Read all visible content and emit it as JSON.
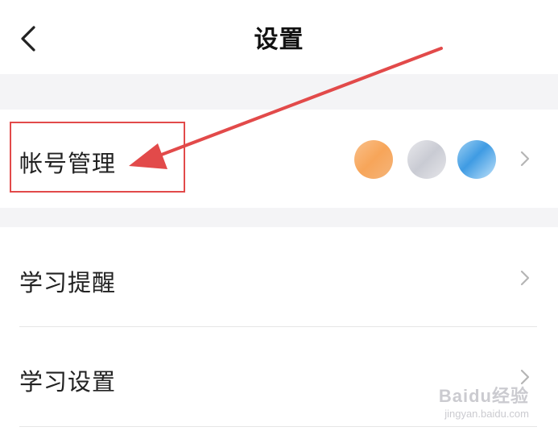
{
  "header": {
    "title": "设置",
    "back_icon": "chevron-left-icon"
  },
  "settings": {
    "items": [
      {
        "label": "帐号管理",
        "chevron_icon": "chevron-right-icon",
        "avatars": [
          "avatar-orange",
          "avatar-gray",
          "avatar-blue"
        ]
      },
      {
        "label": "学习提醒",
        "chevron_icon": "chevron-right-icon"
      },
      {
        "label": "学习设置",
        "chevron_icon": "chevron-right-icon"
      }
    ]
  },
  "annotation": {
    "color": "#e24a4a",
    "arrow_icon": "red-arrow-icon"
  },
  "watermark": {
    "main": "Baidu经验",
    "sub": "jingyan.baidu.com"
  },
  "colors": {
    "background": "#ffffff",
    "section_gap": "#f4f4f6",
    "text": "#222222",
    "chevron": "#b5b5b5",
    "highlight": "#e24a4a"
  }
}
